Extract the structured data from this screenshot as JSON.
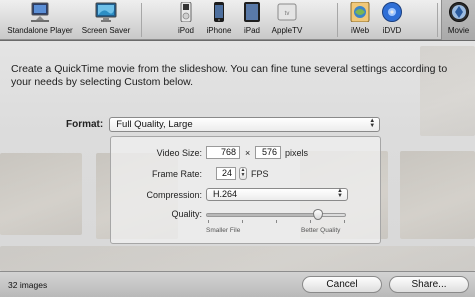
{
  "toolbar": {
    "items": [
      {
        "label": "Standalone Player",
        "icon": "standalone-player-icon"
      },
      {
        "label": "Screen Saver",
        "icon": "screen-saver-icon"
      },
      {
        "label": "iPod",
        "icon": "ipod-icon"
      },
      {
        "label": "iPhone",
        "icon": "iphone-icon"
      },
      {
        "label": "iPad",
        "icon": "ipad-icon"
      },
      {
        "label": "AppleTV",
        "icon": "appletv-icon"
      },
      {
        "label": "iWeb",
        "icon": "iweb-icon"
      },
      {
        "label": "iDVD",
        "icon": "idvd-icon"
      },
      {
        "label": "Movie",
        "icon": "movie-icon"
      }
    ],
    "selected": "Movie"
  },
  "main": {
    "description": "Create a QuickTime movie from the slideshow. You can fine tune several settings according to your needs by selecting Custom below.",
    "format_label": "Format:",
    "format_value": "Full Quality, Large"
  },
  "settings": {
    "video_size_label": "Video Size:",
    "width": "768",
    "times": "×",
    "height": "576",
    "pixels_label": "pixels",
    "frame_rate_label": "Frame Rate:",
    "frame_rate": "24",
    "fps_label": "FPS",
    "compression_label": "Compression:",
    "compression_value": "H.264",
    "quality_label": "Quality:",
    "quality_level": 0.8,
    "smaller_label": "Smaller File",
    "better_label": "Better Quality"
  },
  "footer": {
    "count": "32 images",
    "cancel": "Cancel",
    "share": "Share..."
  },
  "colors": {
    "toolbar_top": "#efefef",
    "toolbar_bottom": "#c9c9c9",
    "selected_bg": "#b3b3b3"
  }
}
